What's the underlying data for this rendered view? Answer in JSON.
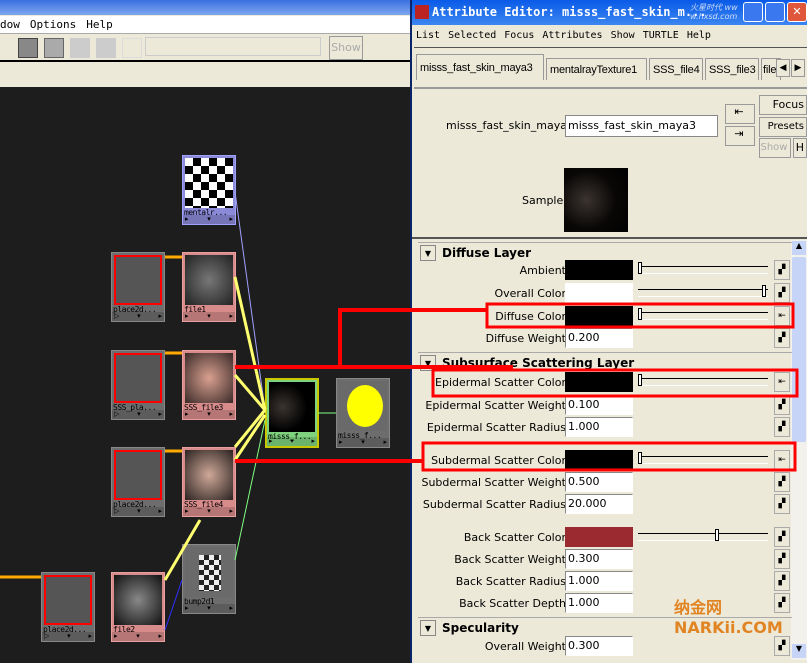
{
  "hypergraph": {
    "menu": [
      "dow",
      "Options",
      "Help"
    ],
    "show_button": "Show",
    "nodes": {
      "mentalray": "mentalr...",
      "file1": "file1",
      "place2d_1": "place2d...",
      "sss_place": "SSS_pla...",
      "sss_file3": "SSS_file3",
      "shader": "misss_f...",
      "shading_group": "misss_f...",
      "place2d_2": "place2d...",
      "sss_file4": "SSS_file4",
      "bump": "bump2d1",
      "place2d_3": "place2d...",
      "file2": "file2"
    }
  },
  "attribute_editor": {
    "title": "Attribute Editor: misss_fast_skin_m...",
    "menu": [
      "List",
      "Selected",
      "Focus",
      "Attributes",
      "Show",
      "TURTLE",
      "Help"
    ],
    "tabs": [
      "misss_fast_skin_maya3",
      "mentalrayTexture1",
      "SSS_file4",
      "SSS_file3",
      "file:"
    ],
    "node_label": "misss_fast_skin_maya:",
    "node_name": "misss_fast_skin_maya3",
    "buttons": {
      "focus": "Focus",
      "presets": "Presets",
      "show": "Show",
      "hide": "H"
    },
    "sample_label": "Sample",
    "sections": {
      "diffuse": "Diffuse Layer",
      "sss": "Subsurface Scattering Layer",
      "spec": "Specularity"
    },
    "attrs": {
      "ambient": {
        "label": "Ambient",
        "color": "#000000",
        "slider": 0
      },
      "overall_color": {
        "label": "Overall Color",
        "color": "#ffffff",
        "slider": 1
      },
      "diffuse_color": {
        "label": "Diffuse Color",
        "color": "#000000",
        "slider": 0
      },
      "diffuse_weight": {
        "label": "Diffuse Weight",
        "value": "0.200"
      },
      "epi_color": {
        "label": "Epidermal Scatter Color",
        "color": "#000000",
        "slider": 0
      },
      "epi_weight": {
        "label": "Epidermal Scatter Weight",
        "value": "0.100"
      },
      "epi_radius": {
        "label": "Epidermal Scatter Radius",
        "value": "1.000"
      },
      "sub_color": {
        "label": "Subdermal Scatter Color",
        "color": "#000000",
        "slider": 0
      },
      "sub_weight": {
        "label": "Subdermal Scatter Weight",
        "value": "0.500"
      },
      "sub_radius": {
        "label": "Subdermal Scatter Radius",
        "value": "20.000"
      },
      "back_color": {
        "label": "Back Scatter Color",
        "color": "#9b2a30",
        "slider": 0.62
      },
      "back_weight": {
        "label": "Back Scatter Weight",
        "value": "0.300"
      },
      "back_radius": {
        "label": "Back Scatter Radius",
        "value": "1.000"
      },
      "back_depth": {
        "label": "Back Scatter Depth",
        "value": "1.000"
      },
      "overall_weight": {
        "label": "Overall Weight",
        "value": "0.300"
      }
    }
  },
  "watermarks": [
    "火星时代 www.hxsd.com",
    "纳金网 NARKii.COM"
  ],
  "colors": {
    "annotation": "#ff0000",
    "canvas": "#1d1d1d",
    "title_bar": "#0a5ae8"
  }
}
